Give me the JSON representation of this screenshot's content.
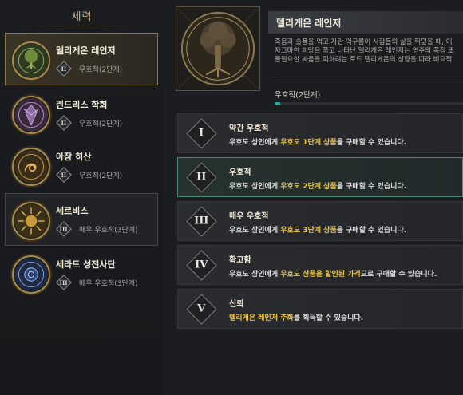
{
  "left_panel": {
    "title": "세력",
    "factions": [
      {
        "name": "델리게온 레인저",
        "rank_numeral": "II",
        "rank": "우호적(2단계)",
        "colors": {
          "bg": "#2e3a22",
          "fg": "#9ab35a"
        }
      },
      {
        "name": "린드리스 학회",
        "rank_numeral": "II",
        "rank": "우호적(2단계)",
        "colors": {
          "bg": "#3a2a3e",
          "fg": "#b696c8"
        }
      },
      {
        "name": "아잠 히산",
        "rank_numeral": "II",
        "rank": "우호적(2단계)",
        "colors": {
          "bg": "#3a2d18",
          "fg": "#d0a050"
        }
      },
      {
        "name": "세르비스",
        "rank_numeral": "III",
        "rank": "매우 우호적(3단계)",
        "colors": {
          "bg": "#3a3018",
          "fg": "#e0b85a"
        }
      },
      {
        "name": "세라드 성전사단",
        "rank_numeral": "III",
        "rank": "매우 우호적(3단계)",
        "colors": {
          "bg": "#1e2a44",
          "fg": "#8aa6d8"
        }
      }
    ]
  },
  "detail": {
    "title": "델리게온 레인저",
    "description_lines": [
      "죽음과 슬픔을 먹고 자란 먹구름이 사람들의 삶을 뒤덮을 때, 어",
      "자그마한 희망을 품고 나타난 델리게온 레인저는 영주의 폭정 또",
      "불필요한 싸움을 피하려는 로드 델리게온의 성향을 따라 비교적"
    ],
    "current_rank": "우호적(2단계)",
    "progress": 0.03
  },
  "tiers": [
    {
      "numeral": "I",
      "name": "약간 우호적",
      "desc_pre": "우호도 상인에게 ",
      "desc_hl": "우호도 1단계 상품",
      "desc_post": "을 구매할 수 있습니다."
    },
    {
      "numeral": "II",
      "name": "우호적",
      "desc_pre": "우호도 상인에게 ",
      "desc_hl": "우호도 2단계 상품",
      "desc_post": "을 구매할 수 있습니다."
    },
    {
      "numeral": "III",
      "name": "매우 우호적",
      "desc_pre": "우호도 상인에게 ",
      "desc_hl": "우호도 3단계 상품",
      "desc_post": "을 구매할 수 있습니다."
    },
    {
      "numeral": "IV",
      "name": "확고함",
      "desc_pre": "우호도 상인에게 ",
      "desc_hl": "우호도 상품을 할인된 가격",
      "desc_post": "으로 구매할 수 있습니다."
    },
    {
      "numeral": "V",
      "name": "신뢰",
      "desc_pre": "",
      "desc_hl": "델리게온 레인저 주화",
      "desc_post": "를 획득할 수 있습니다."
    }
  ]
}
